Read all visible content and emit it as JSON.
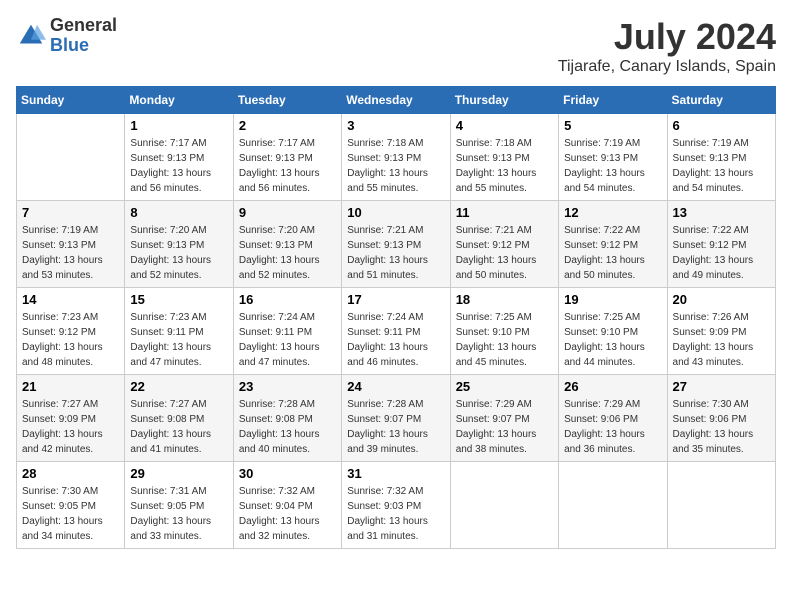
{
  "header": {
    "logo_general": "General",
    "logo_blue": "Blue",
    "month": "July 2024",
    "location": "Tijarafe, Canary Islands, Spain"
  },
  "days_of_week": [
    "Sunday",
    "Monday",
    "Tuesday",
    "Wednesday",
    "Thursday",
    "Friday",
    "Saturday"
  ],
  "weeks": [
    [
      {
        "day": "",
        "sunrise": "",
        "sunset": "",
        "daylight": ""
      },
      {
        "day": "1",
        "sunrise": "Sunrise: 7:17 AM",
        "sunset": "Sunset: 9:13 PM",
        "daylight": "Daylight: 13 hours and 56 minutes."
      },
      {
        "day": "2",
        "sunrise": "Sunrise: 7:17 AM",
        "sunset": "Sunset: 9:13 PM",
        "daylight": "Daylight: 13 hours and 56 minutes."
      },
      {
        "day": "3",
        "sunrise": "Sunrise: 7:18 AM",
        "sunset": "Sunset: 9:13 PM",
        "daylight": "Daylight: 13 hours and 55 minutes."
      },
      {
        "day": "4",
        "sunrise": "Sunrise: 7:18 AM",
        "sunset": "Sunset: 9:13 PM",
        "daylight": "Daylight: 13 hours and 55 minutes."
      },
      {
        "day": "5",
        "sunrise": "Sunrise: 7:19 AM",
        "sunset": "Sunset: 9:13 PM",
        "daylight": "Daylight: 13 hours and 54 minutes."
      },
      {
        "day": "6",
        "sunrise": "Sunrise: 7:19 AM",
        "sunset": "Sunset: 9:13 PM",
        "daylight": "Daylight: 13 hours and 54 minutes."
      }
    ],
    [
      {
        "day": "7",
        "sunrise": "Sunrise: 7:19 AM",
        "sunset": "Sunset: 9:13 PM",
        "daylight": "Daylight: 13 hours and 53 minutes."
      },
      {
        "day": "8",
        "sunrise": "Sunrise: 7:20 AM",
        "sunset": "Sunset: 9:13 PM",
        "daylight": "Daylight: 13 hours and 52 minutes."
      },
      {
        "day": "9",
        "sunrise": "Sunrise: 7:20 AM",
        "sunset": "Sunset: 9:13 PM",
        "daylight": "Daylight: 13 hours and 52 minutes."
      },
      {
        "day": "10",
        "sunrise": "Sunrise: 7:21 AM",
        "sunset": "Sunset: 9:13 PM",
        "daylight": "Daylight: 13 hours and 51 minutes."
      },
      {
        "day": "11",
        "sunrise": "Sunrise: 7:21 AM",
        "sunset": "Sunset: 9:12 PM",
        "daylight": "Daylight: 13 hours and 50 minutes."
      },
      {
        "day": "12",
        "sunrise": "Sunrise: 7:22 AM",
        "sunset": "Sunset: 9:12 PM",
        "daylight": "Daylight: 13 hours and 50 minutes."
      },
      {
        "day": "13",
        "sunrise": "Sunrise: 7:22 AM",
        "sunset": "Sunset: 9:12 PM",
        "daylight": "Daylight: 13 hours and 49 minutes."
      }
    ],
    [
      {
        "day": "14",
        "sunrise": "Sunrise: 7:23 AM",
        "sunset": "Sunset: 9:12 PM",
        "daylight": "Daylight: 13 hours and 48 minutes."
      },
      {
        "day": "15",
        "sunrise": "Sunrise: 7:23 AM",
        "sunset": "Sunset: 9:11 PM",
        "daylight": "Daylight: 13 hours and 47 minutes."
      },
      {
        "day": "16",
        "sunrise": "Sunrise: 7:24 AM",
        "sunset": "Sunset: 9:11 PM",
        "daylight": "Daylight: 13 hours and 47 minutes."
      },
      {
        "day": "17",
        "sunrise": "Sunrise: 7:24 AM",
        "sunset": "Sunset: 9:11 PM",
        "daylight": "Daylight: 13 hours and 46 minutes."
      },
      {
        "day": "18",
        "sunrise": "Sunrise: 7:25 AM",
        "sunset": "Sunset: 9:10 PM",
        "daylight": "Daylight: 13 hours and 45 minutes."
      },
      {
        "day": "19",
        "sunrise": "Sunrise: 7:25 AM",
        "sunset": "Sunset: 9:10 PM",
        "daylight": "Daylight: 13 hours and 44 minutes."
      },
      {
        "day": "20",
        "sunrise": "Sunrise: 7:26 AM",
        "sunset": "Sunset: 9:09 PM",
        "daylight": "Daylight: 13 hours and 43 minutes."
      }
    ],
    [
      {
        "day": "21",
        "sunrise": "Sunrise: 7:27 AM",
        "sunset": "Sunset: 9:09 PM",
        "daylight": "Daylight: 13 hours and 42 minutes."
      },
      {
        "day": "22",
        "sunrise": "Sunrise: 7:27 AM",
        "sunset": "Sunset: 9:08 PM",
        "daylight": "Daylight: 13 hours and 41 minutes."
      },
      {
        "day": "23",
        "sunrise": "Sunrise: 7:28 AM",
        "sunset": "Sunset: 9:08 PM",
        "daylight": "Daylight: 13 hours and 40 minutes."
      },
      {
        "day": "24",
        "sunrise": "Sunrise: 7:28 AM",
        "sunset": "Sunset: 9:07 PM",
        "daylight": "Daylight: 13 hours and 39 minutes."
      },
      {
        "day": "25",
        "sunrise": "Sunrise: 7:29 AM",
        "sunset": "Sunset: 9:07 PM",
        "daylight": "Daylight: 13 hours and 38 minutes."
      },
      {
        "day": "26",
        "sunrise": "Sunrise: 7:29 AM",
        "sunset": "Sunset: 9:06 PM",
        "daylight": "Daylight: 13 hours and 36 minutes."
      },
      {
        "day": "27",
        "sunrise": "Sunrise: 7:30 AM",
        "sunset": "Sunset: 9:06 PM",
        "daylight": "Daylight: 13 hours and 35 minutes."
      }
    ],
    [
      {
        "day": "28",
        "sunrise": "Sunrise: 7:30 AM",
        "sunset": "Sunset: 9:05 PM",
        "daylight": "Daylight: 13 hours and 34 minutes."
      },
      {
        "day": "29",
        "sunrise": "Sunrise: 7:31 AM",
        "sunset": "Sunset: 9:05 PM",
        "daylight": "Daylight: 13 hours and 33 minutes."
      },
      {
        "day": "30",
        "sunrise": "Sunrise: 7:32 AM",
        "sunset": "Sunset: 9:04 PM",
        "daylight": "Daylight: 13 hours and 32 minutes."
      },
      {
        "day": "31",
        "sunrise": "Sunrise: 7:32 AM",
        "sunset": "Sunset: 9:03 PM",
        "daylight": "Daylight: 13 hours and 31 minutes."
      },
      {
        "day": "",
        "sunrise": "",
        "sunset": "",
        "daylight": ""
      },
      {
        "day": "",
        "sunrise": "",
        "sunset": "",
        "daylight": ""
      },
      {
        "day": "",
        "sunrise": "",
        "sunset": "",
        "daylight": ""
      }
    ]
  ]
}
